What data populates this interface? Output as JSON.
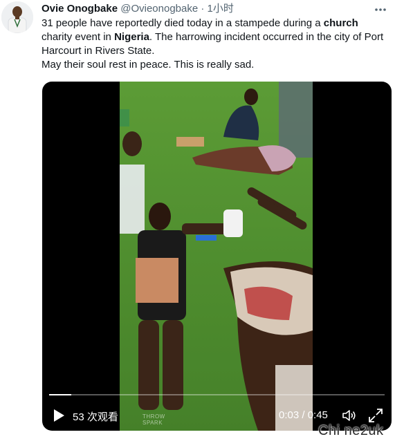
{
  "author": {
    "display_name": "Ovie Onogbake",
    "handle": "@Ovieonogbake",
    "separator": "·",
    "time": "1小时"
  },
  "icons": {
    "more": "more-horizontal-icon",
    "play": "play-icon",
    "volume": "volume-icon",
    "fullscreen": "fullscreen-icon"
  },
  "tweet": {
    "line1_pre": "31 people have reportedly died today in a stampede during a ",
    "line1_bold1": "church",
    "line1_mid": " charity event in ",
    "line1_bold2": "Nigeria",
    "line1_post": ". The harrowing incident occurred in the city of Port Harcourt in Rivers State.",
    "line2": "May their soul rest in peace. This is really sad."
  },
  "video": {
    "views": "53 次观看",
    "timecode": "0:03 / 0:45",
    "progress": 0.067,
    "small_watermark_line1": "THROW",
    "small_watermark_line2": "SPARK"
  },
  "site_watermark": "Chi  ne2uk",
  "colors": {
    "text": "#0f1419",
    "secondary": "#536471",
    "grass": "#4e8a2b"
  }
}
